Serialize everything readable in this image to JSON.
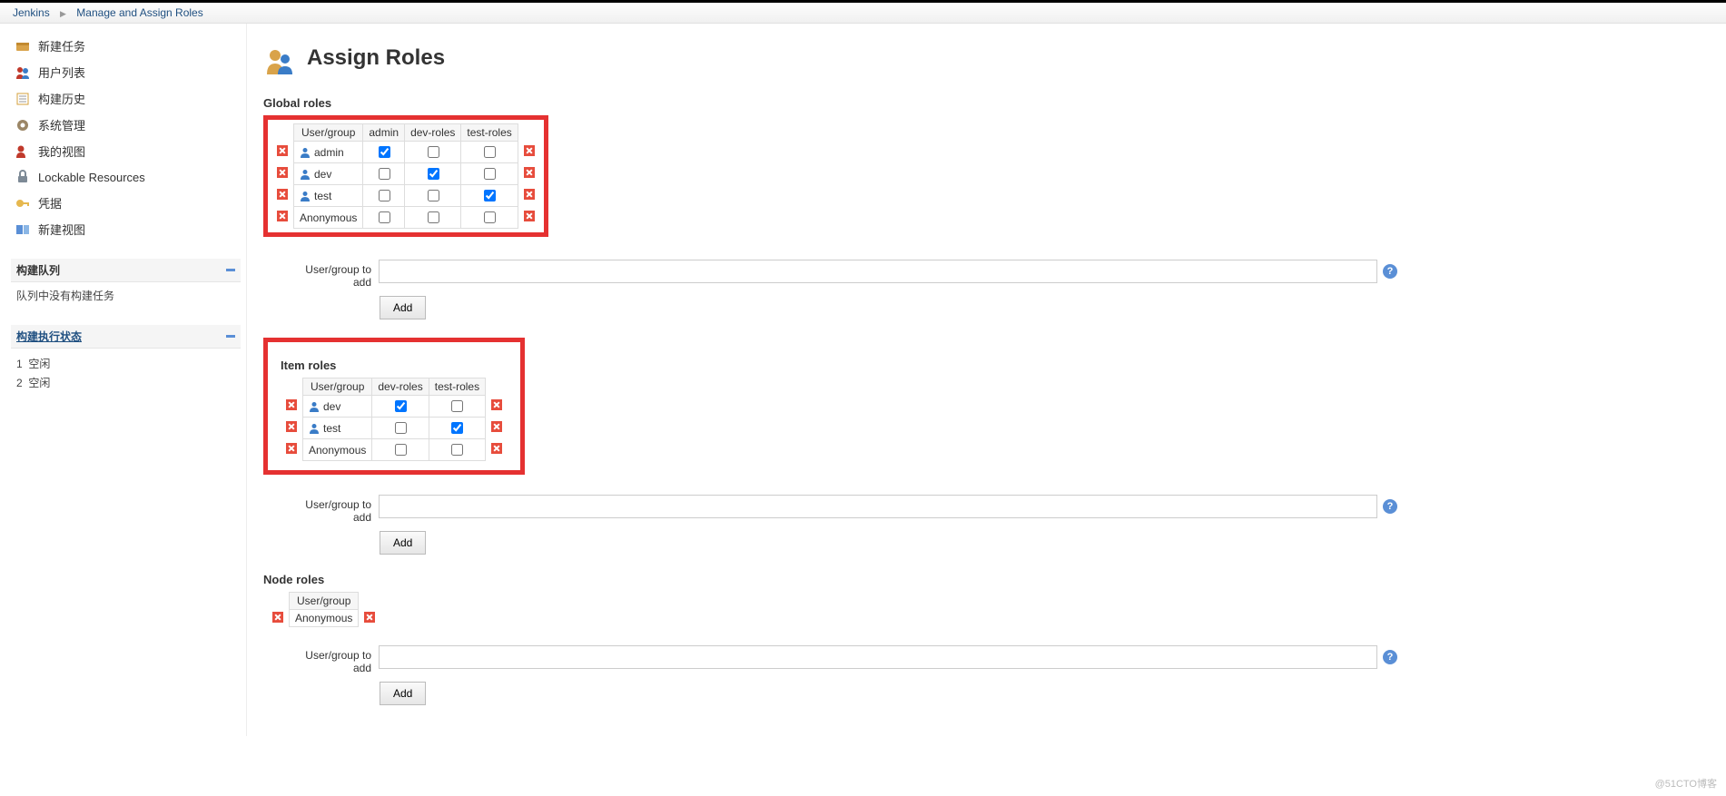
{
  "breadcrumbs": {
    "jenkins": "Jenkins",
    "manage_roles": "Manage and Assign Roles"
  },
  "sidebar": {
    "items": [
      {
        "label": "新建任务"
      },
      {
        "label": "用户列表"
      },
      {
        "label": "构建历史"
      },
      {
        "label": "系统管理"
      },
      {
        "label": "我的视图"
      },
      {
        "label": "Lockable Resources"
      },
      {
        "label": "凭据"
      },
      {
        "label": "新建视图"
      }
    ],
    "build_queue": {
      "title": "构建队列",
      "empty": "队列中没有构建任务"
    },
    "executor_status": {
      "title": "构建执行状态",
      "executors": [
        {
          "num": "1",
          "state": "空闲"
        },
        {
          "num": "2",
          "state": "空闲"
        }
      ]
    }
  },
  "page": {
    "title": "Assign Roles"
  },
  "global_roles": {
    "title": "Global roles",
    "header_user": "User/group",
    "columns": [
      "admin",
      "dev-roles",
      "test-roles"
    ],
    "rows": [
      {
        "name": "admin",
        "has_icon": true,
        "checks": [
          true,
          false,
          false
        ]
      },
      {
        "name": "dev",
        "has_icon": true,
        "checks": [
          false,
          true,
          false
        ]
      },
      {
        "name": "test",
        "has_icon": true,
        "checks": [
          false,
          false,
          true
        ]
      },
      {
        "name": "Anonymous",
        "has_icon": false,
        "checks": [
          false,
          false,
          false
        ]
      }
    ],
    "add_label": "User/group to add",
    "add_button": "Add"
  },
  "item_roles": {
    "title": "Item roles",
    "header_user": "User/group",
    "columns": [
      "dev-roles",
      "test-roles"
    ],
    "rows": [
      {
        "name": "dev",
        "has_icon": true,
        "checks": [
          true,
          false
        ]
      },
      {
        "name": "test",
        "has_icon": true,
        "checks": [
          false,
          true
        ]
      },
      {
        "name": "Anonymous",
        "has_icon": false,
        "checks": [
          false,
          false
        ]
      }
    ],
    "add_label": "User/group to add",
    "add_button": "Add"
  },
  "node_roles": {
    "title": "Node roles",
    "header_user": "User/group",
    "rows": [
      {
        "name": "Anonymous"
      }
    ],
    "add_label": "User/group to add",
    "add_button": "Add"
  },
  "watermark": "@51CTO博客"
}
